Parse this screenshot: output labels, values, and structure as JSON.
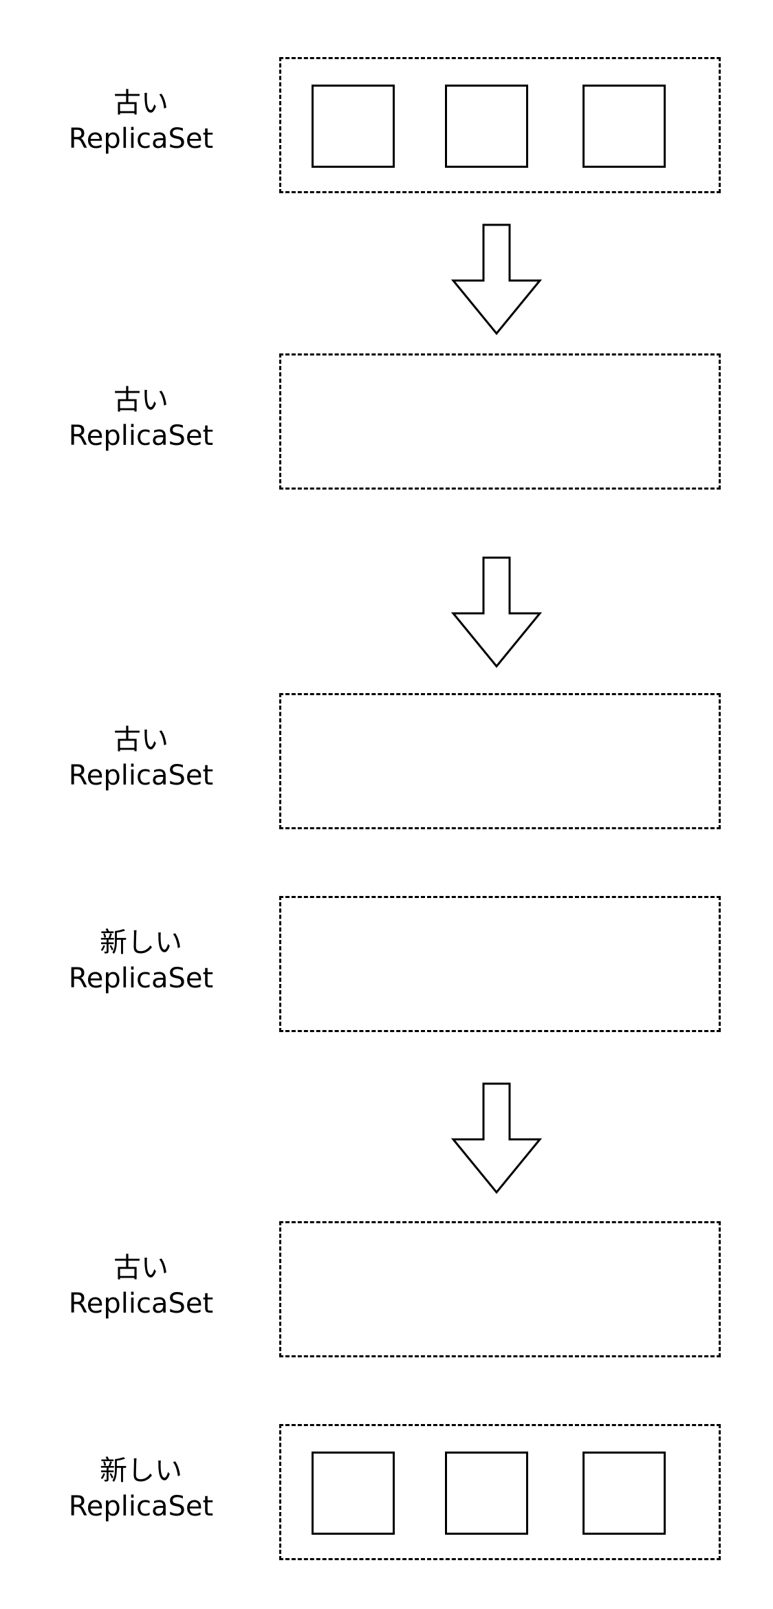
{
  "rows": [
    {
      "line1": "古い",
      "line2": "ReplicaSet"
    },
    {
      "line1": "古い",
      "line2": "ReplicaSet"
    },
    {
      "line1": "古い",
      "line2": "ReplicaSet"
    },
    {
      "line1": "新しい",
      "line2": "ReplicaSet"
    },
    {
      "line1": "古い",
      "line2": "ReplicaSet"
    },
    {
      "line1": "新しい",
      "line2": "ReplicaSet"
    }
  ]
}
